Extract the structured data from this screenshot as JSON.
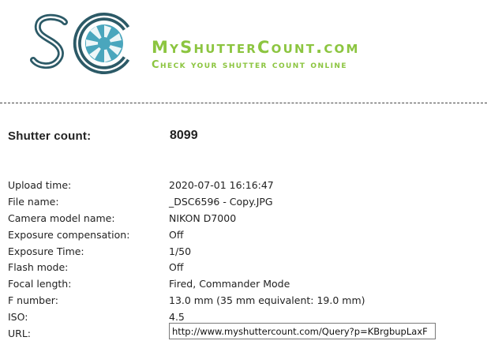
{
  "header": {
    "site_name": "MyShutterCount.com",
    "tagline": "Check your shutter count online",
    "colors": {
      "logo_dark": "#2c5a67",
      "logo_teal": "#4aa6bd",
      "accent": "#8cc540"
    }
  },
  "result": {
    "shutter_label": "Shutter count:",
    "shutter_value": "8099"
  },
  "details": [
    {
      "label": "Upload time:",
      "value": "2020-07-01 16:16:47"
    },
    {
      "label": "File name:",
      "value": "_DSC6596 - Copy.JPG"
    },
    {
      "label": "Camera model name:",
      "value": "NIKON D7000"
    },
    {
      "label": "Exposure compensation:",
      "value": "Off"
    },
    {
      "label": "Exposure Time:",
      "value": "1/50"
    },
    {
      "label": "Flash mode:",
      "value": "Off"
    },
    {
      "label": "Focal length:",
      "value": "Fired, Commander Mode"
    },
    {
      "label": "F number:",
      "value": "13.0 mm (35 mm equivalent: 19.0 mm)"
    },
    {
      "label": "ISO:",
      "value": "4.5"
    }
  ],
  "url": {
    "label": "URL:",
    "value": "http://www.myshuttercount.com/Query?p=KBrgbupLaxF"
  }
}
